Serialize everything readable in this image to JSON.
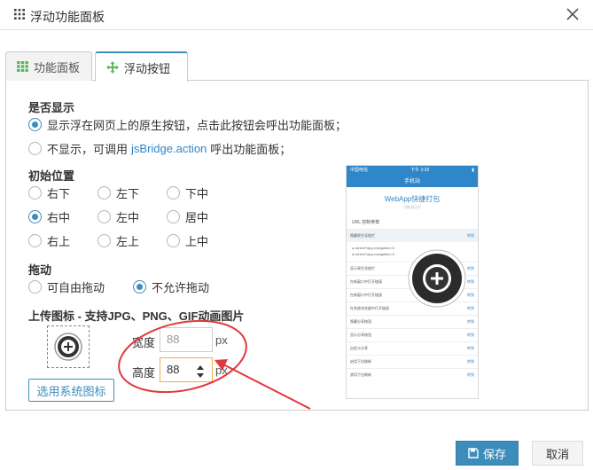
{
  "dialog": {
    "title": "浮动功能面板"
  },
  "tabs": [
    {
      "label": "功能面板"
    },
    {
      "label": "浮动按钮"
    }
  ],
  "display": {
    "title": "是否显示",
    "option_show": "显示浮在网页上的原生按钮，点击此按钮会呼出功能面板；",
    "option_hide_prefix": "不显示，可调用",
    "option_hide_link": "jsBridge.action",
    "option_hide_suffix": "呼出功能面板；",
    "selected": "show"
  },
  "position": {
    "title": "初始位置",
    "options": [
      "右下",
      "左下",
      "下中",
      "右中",
      "左中",
      "居中",
      "右上",
      "左上",
      "上中"
    ],
    "selected": "右中"
  },
  "drag": {
    "title": "拖动",
    "option_free": "可自由拖动",
    "option_locked": "不允许拖动",
    "selected": "不允许拖动"
  },
  "upload": {
    "title": "上传图标 - 支持JPG、PNG、GIF动画图片",
    "width_label": "宽度",
    "width_placeholder": "88",
    "width_unit": "px",
    "height_label": "高度",
    "height_value": "88",
    "height_unit": "px",
    "system_icon_button": "选用系统图标"
  },
  "preview": {
    "status_left": "中国电信",
    "status_time": "下午 3:29",
    "nav_title": "手机站",
    "brand": "WebApp快捷打包",
    "brand_sub": "功能演示页",
    "param_title": "URL 控制参数",
    "rows": [
      {
        "label": "隐藏原生导航栏",
        "right": "转到"
      },
      {
        "label": "显示原生导航栏",
        "right": "转到"
      },
      {
        "label": "在新窗口中打开链接",
        "right": "转到"
      },
      {
        "label": "在新窗口中打开链接",
        "right": "转到"
      },
      {
        "label": "在系统浏览器中打开链接",
        "right": "转到"
      },
      {
        "label": "隐藏分享按钮",
        "right": "转到"
      },
      {
        "label": "显示分享按钮",
        "right": "转到"
      },
      {
        "label": "自定义分享",
        "right": "转到"
      },
      {
        "label": "启用下拉刷新",
        "right": "转到"
      },
      {
        "label": "禁用下拉刷新",
        "right": "转到"
      }
    ],
    "code_lines": [
      "a.cshtml?app-navigation=0",
      "a.cshtml?app-navigation=0"
    ]
  },
  "footer": {
    "save_label": "保存",
    "cancel_label": "取消"
  },
  "colors": {
    "accent": "#3c8dbc",
    "annotation": "#e0393e",
    "link": "#2f86c8"
  }
}
